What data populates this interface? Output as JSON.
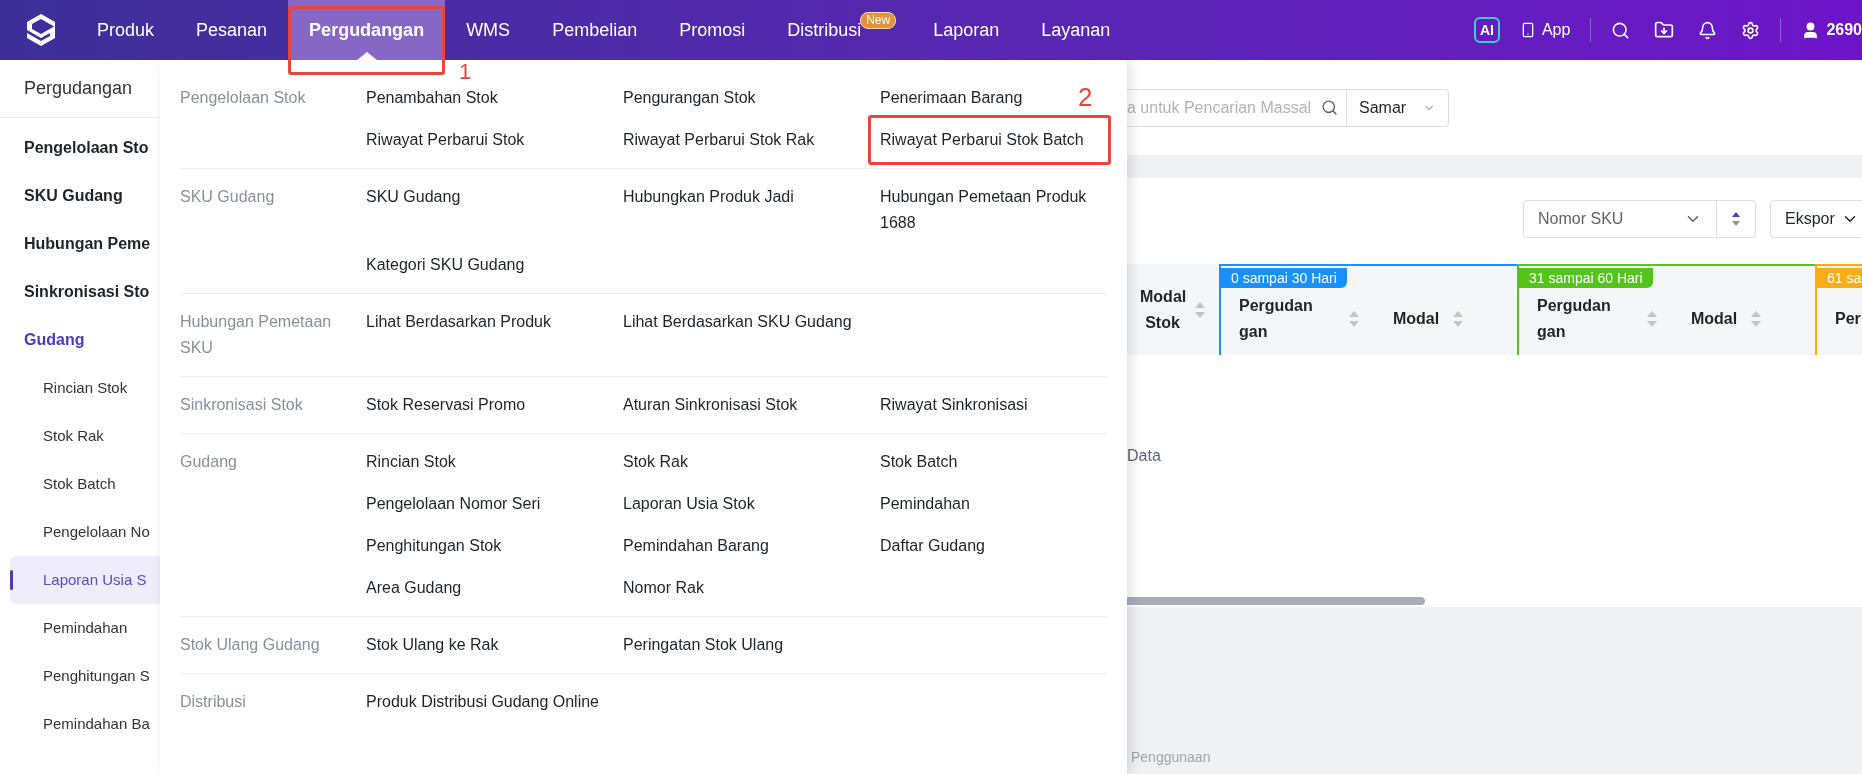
{
  "nav": {
    "items": [
      {
        "label": "Produk",
        "selected": false
      },
      {
        "label": "Pesanan",
        "selected": false
      },
      {
        "label": "Pergudangan",
        "selected": true,
        "annotation": "1"
      },
      {
        "label": "WMS",
        "selected": false
      },
      {
        "label": "Pembelian",
        "selected": false
      },
      {
        "label": "Promosi",
        "selected": false
      },
      {
        "label": "Distribusi",
        "selected": false,
        "badge": "New"
      },
      {
        "label": "Laporan",
        "selected": false
      },
      {
        "label": "Layanan",
        "selected": false
      }
    ],
    "ai": "AI",
    "app": "App",
    "user": "2690"
  },
  "sidebar": {
    "title": "Pergudangan",
    "items": [
      {
        "label": "Pengelolaan Sto",
        "expanded": false
      },
      {
        "label": "SKU Gudang",
        "expanded": false
      },
      {
        "label": "Hubungan Peme",
        "expanded": false
      },
      {
        "label": "Sinkronisasi Sto",
        "expanded": false
      },
      {
        "label": "Gudang",
        "expanded": true,
        "children": [
          {
            "label": "Rincian Stok",
            "selected": false
          },
          {
            "label": "Stok Rak",
            "selected": false
          },
          {
            "label": "Stok Batch",
            "selected": false
          },
          {
            "label": "Pengelolaan No",
            "selected": false
          },
          {
            "label": "Laporan Usia S",
            "selected": true
          },
          {
            "label": "Pemindahan",
            "selected": false
          },
          {
            "label": "Penghitungan S",
            "selected": false
          },
          {
            "label": "Pemindahan Ba",
            "selected": false
          }
        ]
      }
    ]
  },
  "menu": {
    "groups": [
      {
        "label": "Pengelolaan Stok",
        "items": [
          {
            "label": "Penambahan Stok"
          },
          {
            "label": "Pengurangan Stok"
          },
          {
            "label": "Penerimaan Barang"
          },
          {
            "label": "Riwayat Perbarui Stok"
          },
          {
            "label": "Riwayat Perbarui Stok Rak"
          },
          {
            "label": "Riwayat Perbarui Stok Batch",
            "annotation": "2"
          }
        ]
      },
      {
        "label": "SKU Gudang",
        "items": [
          {
            "label": "SKU Gudang"
          },
          {
            "label": "Hubungkan Produk Jadi"
          },
          {
            "label": "Hubungan Pemetaan Produk 1688"
          },
          {
            "label": "Kategori SKU Gudang"
          }
        ]
      },
      {
        "label": "Hubungan Pemetaan SKU",
        "items": [
          {
            "label": "Lihat Berdasarkan Produk"
          },
          {
            "label": "Lihat Berdasarkan SKU Gudang"
          }
        ]
      },
      {
        "label": "Sinkronisasi Stok",
        "items": [
          {
            "label": "Stok Reservasi Promo"
          },
          {
            "label": "Aturan Sinkronisasi Stok"
          },
          {
            "label": "Riwayat Sinkronisasi"
          }
        ]
      },
      {
        "label": "Gudang",
        "items": [
          {
            "label": "Rincian Stok"
          },
          {
            "label": "Stok Rak"
          },
          {
            "label": "Stok Batch"
          },
          {
            "label": "Pengelolaan Nomor Seri"
          },
          {
            "label": "Laporan Usia Stok"
          },
          {
            "label": "Pemindahan"
          },
          {
            "label": "Penghitungan Stok"
          },
          {
            "label": "Pemindahan Barang"
          },
          {
            "label": "Daftar Gudang"
          },
          {
            "label": "Area Gudang"
          },
          {
            "label": "Nomor Rak"
          }
        ]
      },
      {
        "label": "Stok Ulang Gudang",
        "items": [
          {
            "label": "Stok Ulang ke Rak"
          },
          {
            "label": "Peringatan Stok Ulang"
          }
        ]
      },
      {
        "label": "Distribusi",
        "items": [
          {
            "label": "Produk Distribusi Gudang Online"
          }
        ]
      }
    ]
  },
  "content": {
    "search": {
      "placeholder": "a untuk Pencarian Massal"
    },
    "match": "Samar",
    "sort": "Nomor SKU",
    "export": "Ekspor",
    "table": {
      "first_column": "Modal Stok",
      "groups": [
        {
          "label": "0 sampai 30 Hari",
          "color": "#1890ff",
          "columns": [
            "Pergudangan",
            "Modal"
          ]
        },
        {
          "label": "31 sampai 60 Hari",
          "color": "#52c41a",
          "columns": [
            "Pergudangan",
            "Modal"
          ]
        },
        {
          "label": "61 sa",
          "color": "#faad14",
          "columns": [
            "Per"
          ]
        }
      ]
    },
    "empty": "Data",
    "footer": "Penggunaan"
  }
}
